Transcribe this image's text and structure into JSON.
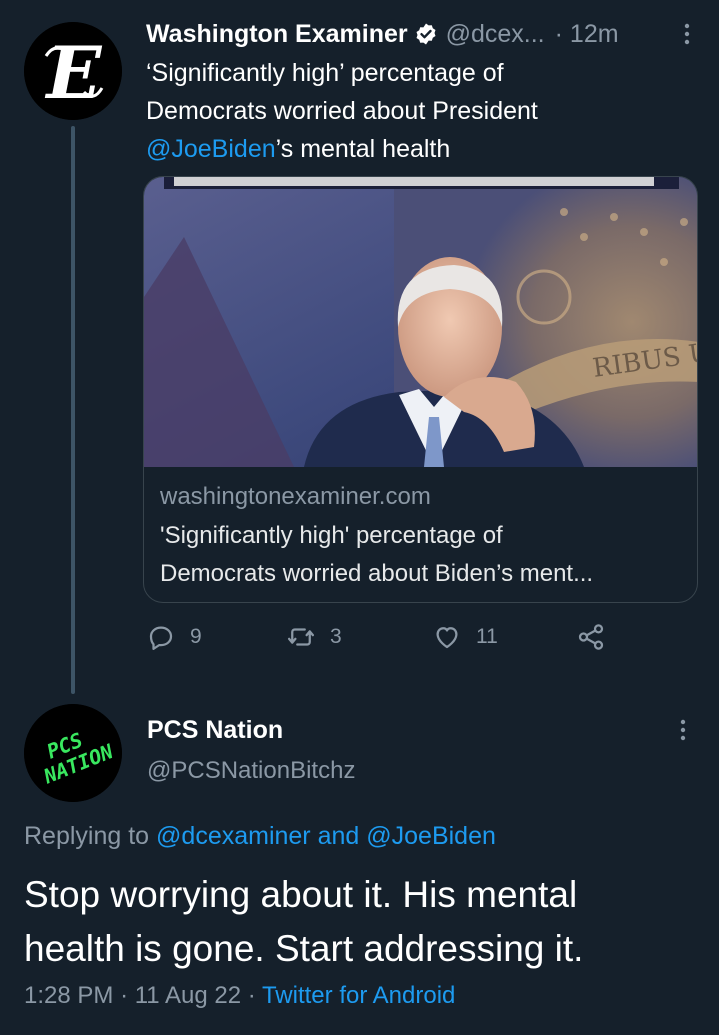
{
  "parent_tweet": {
    "display_name": "Washington Examiner",
    "handle": "@dcex...",
    "time": "· 12m",
    "avatar_letter": "E",
    "text_line1": "‘Significantly high’ percentage of",
    "text_line2": "Democrats worried about President",
    "text_mention": "@JoeBiden",
    "text_line3_rest": "’s mental health",
    "card": {
      "image_text": "RIBUS UNUM",
      "domain": "washingtonexaminer.com",
      "title_line1": "'Significantly high' percentage of",
      "title_line2": "Democrats worried about Biden’s ment..."
    },
    "actions": {
      "replies": "9",
      "retweets": "3",
      "likes": "11"
    }
  },
  "reply_tweet": {
    "display_name": "PCS Nation",
    "handle": "@PCSNationBitchz",
    "avatar_text_1": "PCS",
    "avatar_text_2": "NATION",
    "replying_prefix": "Replying to",
    "replying_to_1": "@dcexaminer",
    "replying_and": "and",
    "replying_to_2": "@JoeBiden",
    "body_line1": "Stop worrying about it. His mental",
    "body_line2": "health is gone. Start addressing it.",
    "time": "1:28 PM",
    "date": "11 Aug 22",
    "sep": "·",
    "source": "Twitter for Android"
  },
  "colors": {
    "background": "#15202b",
    "accent": "#1d9bf0",
    "secondary_text": "#8b98a5",
    "reply_avatar_text": "#39e75f"
  }
}
